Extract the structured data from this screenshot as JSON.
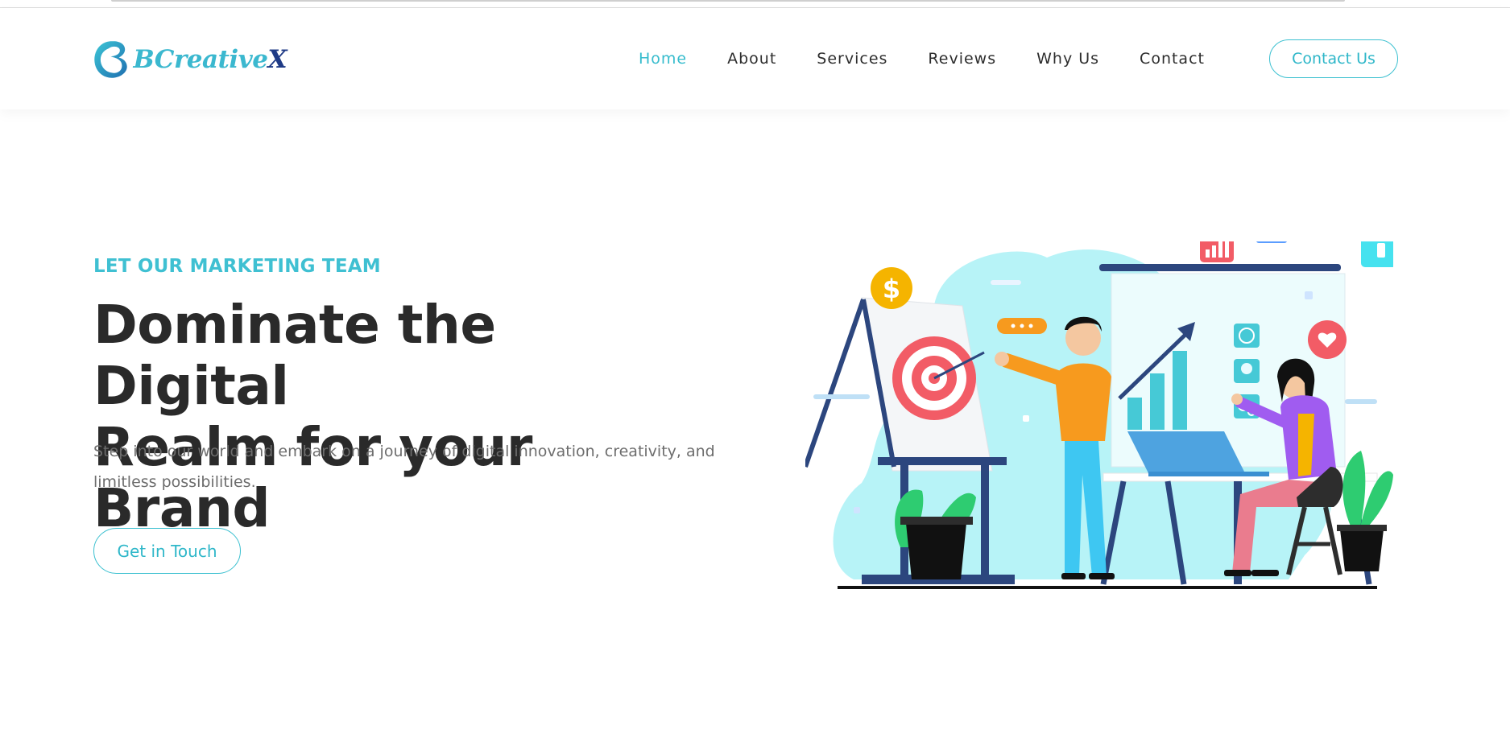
{
  "brand": {
    "name_main": "BCreative",
    "name_accent": "X",
    "accent_color": "#3cc0d0",
    "brand_dark": "#1f3b86"
  },
  "nav": {
    "items": [
      {
        "label": "Home",
        "active": true
      },
      {
        "label": "About",
        "active": false
      },
      {
        "label": "Services",
        "active": false
      },
      {
        "label": "Reviews",
        "active": false
      },
      {
        "label": "Why Us",
        "active": false
      },
      {
        "label": "Contact",
        "active": false
      }
    ],
    "cta_label": "Contact Us"
  },
  "hero": {
    "eyebrow": "LET OUR MARKETING TEAM",
    "title_line1": "Dominate the Digital",
    "title_line2": "Realm for your Brand",
    "description": "Step into our world and embark on a journey of digital innovation, creativity, and limitless possibilities.",
    "cta_label": "Get in Touch",
    "illustration_icons": [
      "dollar-coin-icon",
      "bar-chart-icon",
      "thumbs-up-icon",
      "heart-icon",
      "target-icon",
      "lightbulb-icon",
      "gears-icon",
      "plant-icon"
    ]
  }
}
